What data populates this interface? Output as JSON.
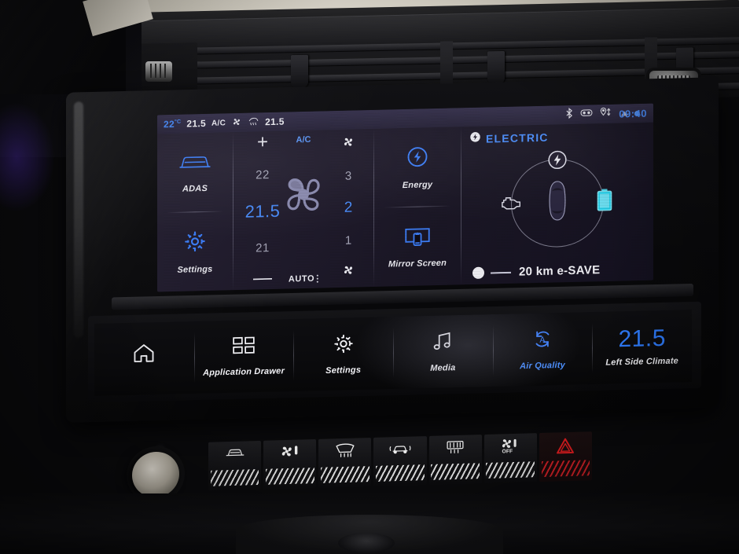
{
  "status_bar": {
    "outside_temp": "22",
    "outside_temp_unit": "°C",
    "driver_temp": "21.5",
    "driver_temp_decimal": ".5",
    "ac_label": "A/C",
    "fan_icon": "fan-icon",
    "defrost_icon": "windshield-defrost-icon",
    "passenger_temp": "21.5",
    "bluetooth_icon": "bluetooth-icon",
    "media_icon": "media-device-icon",
    "navigation_icon": "navigation-pin-icon",
    "clock": "09:40"
  },
  "left_panel": {
    "adas": {
      "label": "ADAS",
      "icon": "car-front-icon"
    },
    "settings": {
      "label": "Settings",
      "icon": "gear-icon"
    }
  },
  "climate_panel": {
    "ac_label": "A/C",
    "increase_icon": "plus-icon",
    "decrease_icon": "minus-icon",
    "temp_above": "22",
    "temp_selected": "21.5",
    "temp_below": "21",
    "fan_up_icon": "fan-increase-icon",
    "fan_down_icon": "fan-decrease-icon",
    "fan_above": "3",
    "fan_selected": "2",
    "fan_below": "1",
    "blower_icon": "blower-fan-icon",
    "auto_label": "AUTO"
  },
  "function_panel": {
    "energy": {
      "label": "Energy",
      "icon": "energy-bolt-icon"
    },
    "mirror_screen": {
      "label": "Mirror Screen",
      "icon": "screen-mirroring-icon"
    }
  },
  "electric_panel": {
    "badge_icon": "electric-bolt-badge-icon",
    "title": "ELECTRIC",
    "flow_bolt_icon": "charge-bolt-icon",
    "engine_icon": "engine-icon",
    "vehicle_icon": "car-top-view-icon",
    "battery_icon": "battery-icon",
    "battery_color": "#22d3ee",
    "slider_icon": "slider-handle",
    "range_text": "20 km e-SAVE"
  },
  "touch_bar": {
    "items": [
      {
        "label": "",
        "icon": "home-icon",
        "accent": false
      },
      {
        "label": "Application Drawer",
        "icon": "grid-apps-icon",
        "accent": false
      },
      {
        "label": "Settings",
        "icon": "gear-icon",
        "accent": false
      },
      {
        "label": "Media",
        "icon": "music-note-icon",
        "accent": false
      },
      {
        "label": "Air Quality",
        "icon": "air-recirculation-auto-icon",
        "accent": true
      }
    ],
    "climate": {
      "value": "21.5",
      "label": "Left Side Climate"
    }
  },
  "hardware_buttons": [
    {
      "name": "vehicle-menu-button",
      "icon": "car-side-icon"
    },
    {
      "name": "climate-button",
      "icon": "fan-thermometer-icon"
    },
    {
      "name": "front-defrost-button",
      "icon": "windshield-defrost-icon"
    },
    {
      "name": "park-assist-button",
      "icon": "car-parking-sensors-icon"
    },
    {
      "name": "rear-defrost-button",
      "icon": "rear-window-defrost-icon"
    },
    {
      "name": "ac-off-button",
      "icon": "ac-off-icon",
      "sub": "OFF"
    },
    {
      "name": "hazard-button",
      "icon": "hazard-triangle-icon",
      "color": "#e11d20"
    }
  ],
  "colors": {
    "accent_blue": "#4b8fff",
    "screen_bg": "#241f31",
    "text": "#f2f2f6",
    "battery_cyan": "#22d3ee",
    "hazard_red": "#e11d20"
  }
}
